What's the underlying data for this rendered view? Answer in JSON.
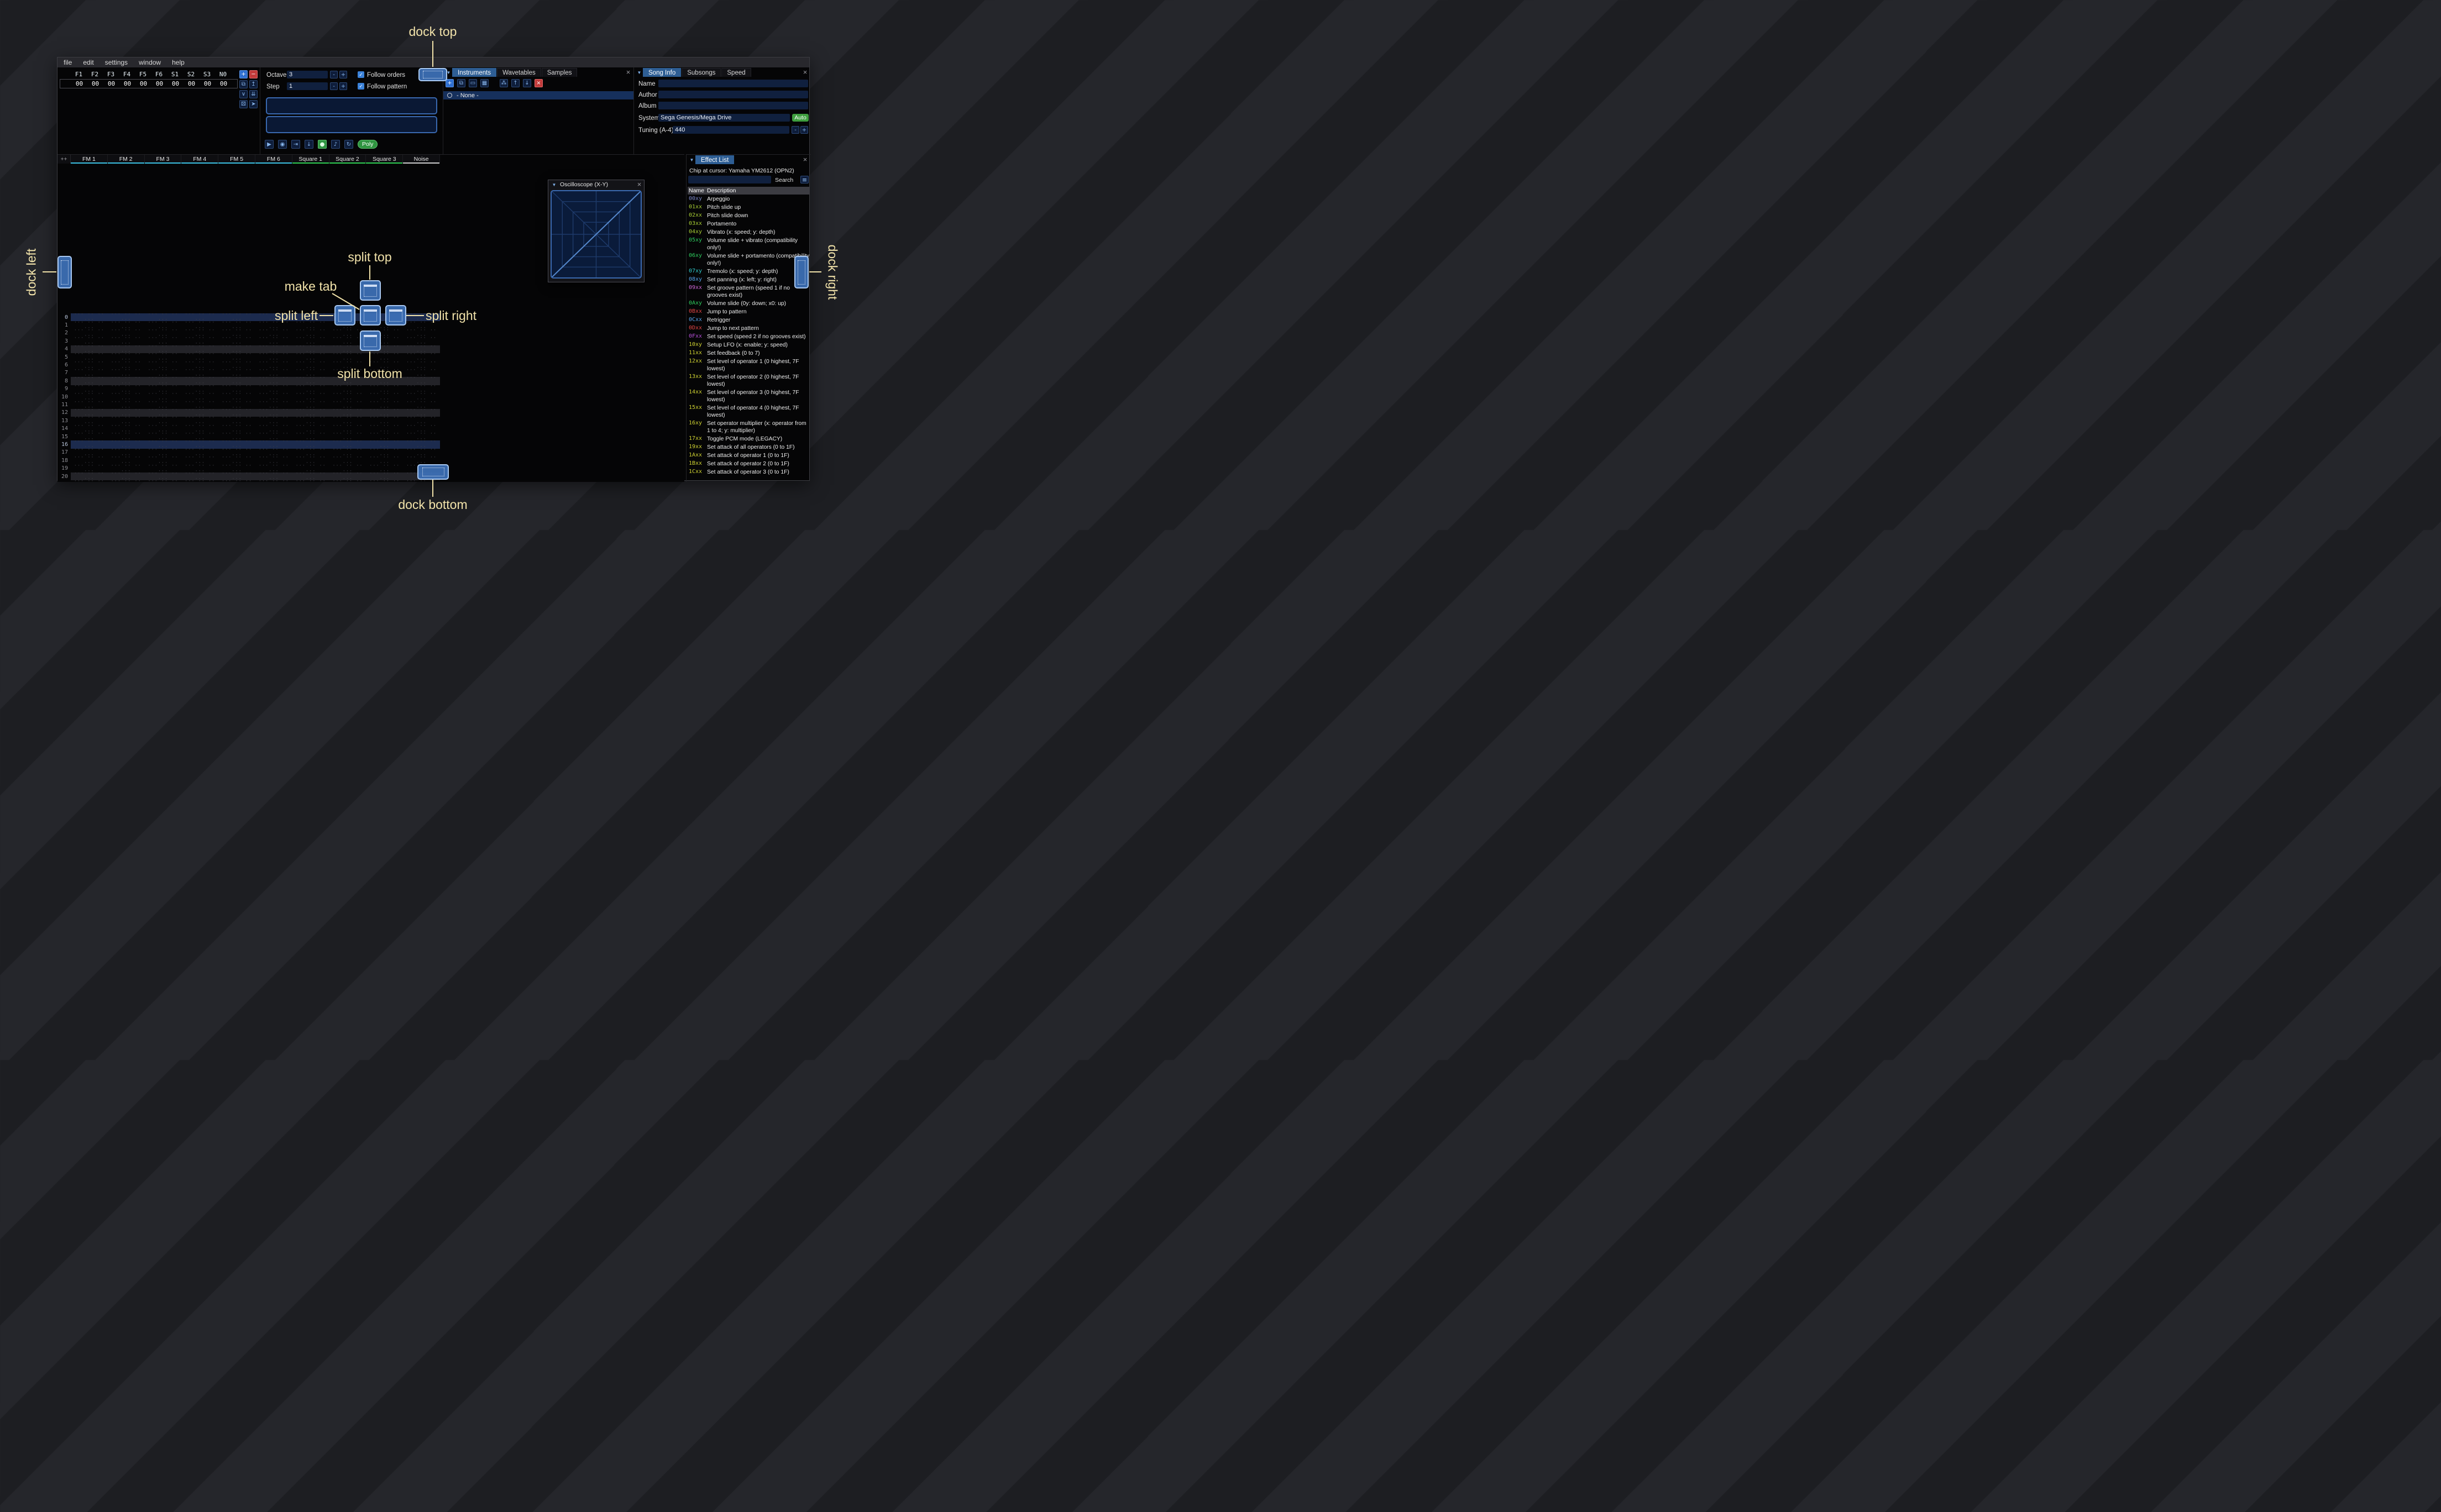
{
  "window": {
    "menu": [
      "file",
      "edit",
      "settings",
      "window",
      "help"
    ]
  },
  "order": {
    "columns": [
      "F1",
      "F2",
      "F3",
      "F4",
      "F5",
      "F6",
      "S1",
      "S2",
      "S3",
      "N0"
    ],
    "row_values": [
      "00",
      "00",
      "00",
      "00",
      "00",
      "00",
      "00",
      "00",
      "00",
      "00"
    ],
    "buttons": [
      {
        "name": "add-order-button",
        "glyph": "+",
        "style": "blue"
      },
      {
        "name": "remove-order-button",
        "glyph": "−",
        "style": "red"
      },
      {
        "name": "duplicate-order-button",
        "glyph": "⧉",
        "style": ""
      },
      {
        "name": "move-order-up-button",
        "glyph": "↥",
        "style": ""
      },
      {
        "name": "move-order-down-button",
        "glyph": "∨",
        "style": ""
      },
      {
        "name": "duplicate-order-deep-button",
        "glyph": "⇊",
        "style": ""
      },
      {
        "name": "order-change-mode-button",
        "glyph": "⚄",
        "style": ""
      },
      {
        "name": "order-edit-mode-button",
        "glyph": "➤",
        "style": ""
      }
    ]
  },
  "controls": {
    "octave_label": "Octave",
    "octave_value": "3",
    "step_label": "Step",
    "step_value": "1",
    "minus": "-",
    "plus": "+",
    "follow_orders": "Follow orders",
    "follow_pattern": "Follow pattern",
    "poly": "Poly",
    "transport": [
      {
        "name": "play-button",
        "glyph": "▶",
        "style": ""
      },
      {
        "name": "play-pattern-button",
        "glyph": "◉",
        "style": ""
      },
      {
        "name": "play-from-cursor-button",
        "glyph": "⇥",
        "style": ""
      },
      {
        "name": "step-one-row-button",
        "glyph": "↓",
        "style": ""
      },
      {
        "name": "edit-toggle-button",
        "glyph": "●",
        "style": "green"
      },
      {
        "name": "metronome-button",
        "glyph": "♪",
        "style": ""
      },
      {
        "name": "repeat-pattern-button",
        "glyph": "↻",
        "style": ""
      }
    ]
  },
  "instruments": {
    "tabs": [
      "Instruments",
      "Wavetables",
      "Samples"
    ],
    "selected_tab": "Instruments",
    "toolbar": [
      {
        "name": "add-instrument-button",
        "glyph": "+",
        "style": "blue"
      },
      {
        "name": "duplicate-instrument-button",
        "glyph": "⧉",
        "style": ""
      },
      {
        "name": "open-instrument-button",
        "glyph": "▭",
        "style": ""
      },
      {
        "name": "save-instrument-button",
        "glyph": "▦",
        "style": ""
      },
      {
        "name": "instrument-folders-button",
        "glyph": "⁂",
        "style": "gap"
      },
      {
        "name": "move-instrument-up-button",
        "glyph": "↑",
        "style": ""
      },
      {
        "name": "move-instrument-down-button",
        "glyph": "↓",
        "style": ""
      },
      {
        "name": "delete-instrument-button",
        "glyph": "×",
        "style": "red"
      }
    ],
    "list": [
      {
        "label": "- None -"
      }
    ]
  },
  "song_info": {
    "tabs": [
      "Song Info",
      "Subsongs",
      "Speed"
    ],
    "selected_tab": "Song Info",
    "name_label": "Name",
    "name_value": "",
    "author_label": "Author",
    "author_value": "",
    "album_label": "Album",
    "album_value": "",
    "system_label": "System",
    "system_value": "Sega Genesis/Mega Drive",
    "auto_button": "Auto",
    "tuning_label": "Tuning (A-4)",
    "tuning_value": "440",
    "minus": "-",
    "plus": "+"
  },
  "pattern": {
    "corner": "++",
    "row_count": 22,
    "major_rows": [
      0,
      16
    ],
    "minor_rows": [
      4,
      8,
      12,
      20
    ],
    "cell_dots": "··· ·· ·· ···",
    "channels": [
      {
        "name": "FM 1",
        "color": "#3cc3e6"
      },
      {
        "name": "FM 2",
        "color": "#3cc3e6"
      },
      {
        "name": "FM 3",
        "color": "#3cc3e6"
      },
      {
        "name": "FM 4",
        "color": "#3cc3e6"
      },
      {
        "name": "FM 5",
        "color": "#3cc3e6"
      },
      {
        "name": "FM 6",
        "color": "#3cc3e6"
      },
      {
        "name": "Square 1",
        "color": "#2ed052"
      },
      {
        "name": "Square 2",
        "color": "#2ed052"
      },
      {
        "name": "Square 3",
        "color": "#2ed052"
      },
      {
        "name": "Noise",
        "color": "#cfcfcf"
      }
    ]
  },
  "oscilloscope": {
    "title": "Oscilloscope (X-Y)"
  },
  "effect_list": {
    "title": "Effect List",
    "chip_line": "Chip at cursor: Yamaha YM2612 (OPN2)",
    "search_label": "Search",
    "search_value": "",
    "name_header": "Name",
    "desc_header": "Description",
    "effects": [
      {
        "code": "00xy",
        "desc": "Arpeggio",
        "color": "#7b87c8"
      },
      {
        "code": "01xx",
        "desc": "Pitch slide up",
        "color": "#a6cc34"
      },
      {
        "code": "02xx",
        "desc": "Pitch slide down",
        "color": "#a6cc34"
      },
      {
        "code": "03xx",
        "desc": "Portamento",
        "color": "#a6cc34"
      },
      {
        "code": "04xy",
        "desc": "Vibrato (x: speed; y: depth)",
        "color": "#a6cc34"
      },
      {
        "code": "05xy",
        "desc": "Volume slide + vibrato (compatibility only!)",
        "color": "#2ecc5e"
      },
      {
        "code": "06xy",
        "desc": "Volume slide + portamento (compatibility only!)",
        "color": "#2ecc5e"
      },
      {
        "code": "07xy",
        "desc": "Tremolo (x: speed; y: depth)",
        "color": "#2fc9c9"
      },
      {
        "code": "08xy",
        "desc": "Set panning (x: left; y: right)",
        "color": "#54a0e8"
      },
      {
        "code": "09xx",
        "desc": "Set groove pattern (speed 1 if no grooves exist)",
        "color": "#cc66d4"
      },
      {
        "code": "0Axy",
        "desc": "Volume slide (0y: down; x0: up)",
        "color": "#2ecc5e"
      },
      {
        "code": "0Bxx",
        "desc": "Jump to pattern",
        "color": "#e04545"
      },
      {
        "code": "0Cxx",
        "desc": "Retrigger",
        "color": "#54a0e8"
      },
      {
        "code": "0Dxx",
        "desc": "Jump to next pattern",
        "color": "#e04545"
      },
      {
        "code": "0Fxx",
        "desc": "Set speed (speed 2 if no grooves exist)",
        "color": "#b44fd6"
      },
      {
        "code": "10xy",
        "desc": "Setup LFO (x: enable; y: speed)",
        "color": "#cfd232"
      },
      {
        "code": "11xx",
        "desc": "Set feedback (0 to 7)",
        "color": "#cfd232"
      },
      {
        "code": "12xx",
        "desc": "Set level of operator 1 (0 highest, 7F lowest)",
        "color": "#cfd232"
      },
      {
        "code": "13xx",
        "desc": "Set level of operator 2 (0 highest, 7F lowest)",
        "color": "#cfd232"
      },
      {
        "code": "14xx",
        "desc": "Set level of operator 3 (0 highest, 7F lowest)",
        "color": "#cfd232"
      },
      {
        "code": "15xx",
        "desc": "Set level of operator 4 (0 highest, 7F lowest)",
        "color": "#cfd232"
      },
      {
        "code": "16xy",
        "desc": "Set operator multiplier (x: operator from 1 to 4; y: multiplier)",
        "color": "#cfd232"
      },
      {
        "code": "17xx",
        "desc": "Toggle PCM mode (LEGACY)",
        "color": "#cfd232"
      },
      {
        "code": "19xx",
        "desc": "Set attack of all operators (0 to 1F)",
        "color": "#cfd232"
      },
      {
        "code": "1Axx",
        "desc": "Set attack of operator 1 (0 to 1F)",
        "color": "#cfd232"
      },
      {
        "code": "1Bxx",
        "desc": "Set attack of operator 2 (0 to 1F)",
        "color": "#cfd232"
      },
      {
        "code": "1Cxx",
        "desc": "Set attack of operator 3 (0 to 1F)",
        "color": "#cfd232"
      }
    ]
  },
  "dock_labels": {
    "dock_top": "dock top",
    "dock_left": "dock left",
    "dock_right": "dock right",
    "dock_bottom": "dock bottom",
    "split_top": "split top",
    "split_left": "split left",
    "split_right": "split right",
    "split_bottom": "split bottom",
    "make_tab": "make tab"
  },
  "colors": {
    "accent": "#2e5e94",
    "dock_target": "#3e72ba",
    "dock_label": "#f2e3aa",
    "green_button": "#3f9f3f",
    "red_button": "#c23a3a",
    "major_row": "#1c2b4e",
    "minor_row": "#232328"
  }
}
